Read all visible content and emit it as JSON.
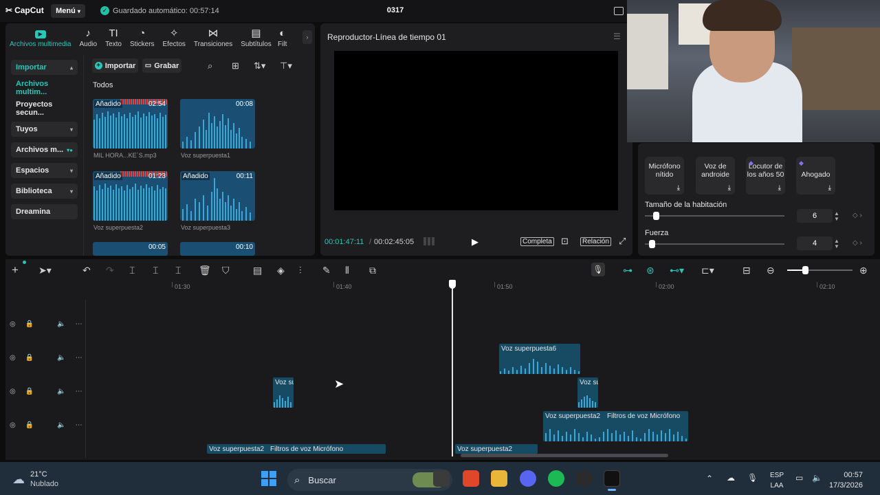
{
  "app": {
    "name": "CapCut",
    "menu_label": "Menú",
    "autosave": "Guardado automático: 00:57:14",
    "project_title": "0317"
  },
  "media_tabs": [
    {
      "label": "Archivos multimedia",
      "icon": "media-icon",
      "active": true
    },
    {
      "label": "Audio",
      "icon": "audio-icon"
    },
    {
      "label": "Texto",
      "icon": "text-icon"
    },
    {
      "label": "Stickers",
      "icon": "sticker-icon"
    },
    {
      "label": "Efectos",
      "icon": "effects-icon"
    },
    {
      "label": "Transiciones",
      "icon": "transition-icon"
    },
    {
      "label": "Subtítulos",
      "icon": "subtitles-icon"
    },
    {
      "label": "Filt",
      "icon": "filter-icon"
    }
  ],
  "sidebar": {
    "items": [
      {
        "label": "Importar"
      },
      {
        "label": "Archivos multim..."
      },
      {
        "label": "Proyectos secun..."
      },
      {
        "label": "Tuyos"
      },
      {
        "label": "Archivos m..."
      },
      {
        "label": "Espacios"
      },
      {
        "label": "Biblioteca"
      },
      {
        "label": "Dreamina"
      }
    ]
  },
  "media_toolbar": {
    "import": "Importar",
    "record": "Grabar"
  },
  "media_section": "Todos",
  "media_items": [
    {
      "added": "Añadido",
      "duration": "02:54",
      "name": "MIL HORA...KE´S.mp3"
    },
    {
      "added": "",
      "duration": "00:08",
      "name": "Voz superpuesta1"
    },
    {
      "added": "Añadido",
      "duration": "01:23",
      "name": "Voz superpuesta2"
    },
    {
      "added": "Añadido",
      "duration": "00:11",
      "name": "Voz superpuesta3"
    },
    {
      "added": "",
      "duration": "00:05",
      "name": ""
    },
    {
      "added": "",
      "duration": "00:10",
      "name": ""
    }
  ],
  "player": {
    "title": "Reproductor-Línea de tiempo 01",
    "current_time": "00:01:47:11",
    "total_time": "00:02:45:05",
    "full_label": "Completa",
    "ratio_label": "Relación"
  },
  "voice_filters": [
    {
      "label": "Micrófono nítido",
      "premium": false
    },
    {
      "label": "Voz de androide",
      "premium": false
    },
    {
      "label": "Locutor de los años 50",
      "premium": true
    },
    {
      "label": "Ahogado",
      "premium": true
    }
  ],
  "params": {
    "room_size_label": "Tamaño de la habitación",
    "room_size_value": "6",
    "room_size_level": 0.06,
    "strength_label": "Fuerza",
    "strength_value": "4",
    "strength_level": 0.04
  },
  "ruler": [
    "01:30",
    "01:40",
    "01:50",
    "02:00",
    "02:10"
  ],
  "clips": {
    "c1": "Voz superpuesta6",
    "c2": "Voz su",
    "c3": "Voz su",
    "c4": "Voz superpuesta2",
    "c5": "Filtros de voz Micrófono",
    "c6": "Voz superpuesta2",
    "c7": "Filtros de voz Micrófono",
    "c8": "Voz superpuesta2"
  },
  "taskbar": {
    "temperature": "21°C",
    "weather": "Nublado",
    "search_placeholder": "Buscar",
    "lang1": "ESP",
    "lang2": "LAA",
    "time": "00:57",
    "date": "17/3/2026"
  },
  "colors": {
    "accent": "#29c7b7",
    "clip": "#174a63",
    "background": "#0d0d0e"
  }
}
